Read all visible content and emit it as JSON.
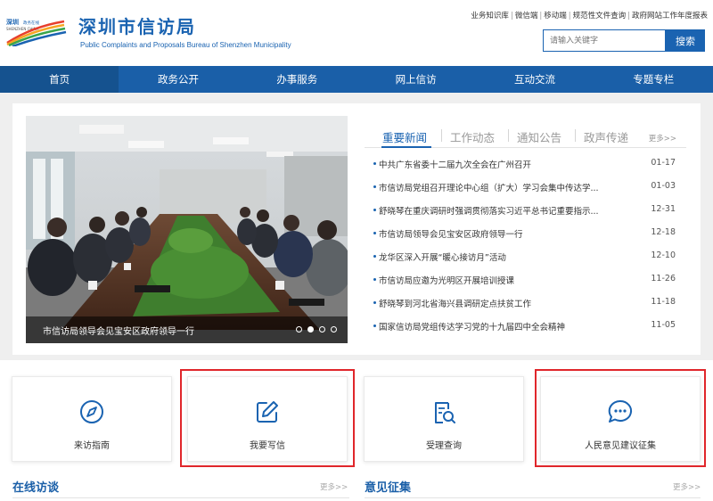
{
  "header": {
    "title": "深圳市信访局",
    "subtitle": "Public Complaints and Proposals Bureau of Shenzhen Municipality",
    "logo_text": "深圳 政务在线 SHENZHEN CHINA",
    "top_links": [
      "业务知识库",
      "微信端",
      "移动端",
      "规范性文件查询",
      "政府网站工作年度报表"
    ],
    "search": {
      "placeholder": "请输入关键字",
      "button_label": "搜索"
    }
  },
  "nav": {
    "items": [
      "首页",
      "政务公开",
      "办事服务",
      "网上信访",
      "互动交流",
      "专题专栏"
    ],
    "active_index": 0
  },
  "slider": {
    "caption": "市信访局领导会见宝安区政府领导一行",
    "dot_count": 4,
    "active_dot": 1
  },
  "news": {
    "tabs": [
      "重要新闻",
      "工作动态",
      "通知公告",
      "政声传递"
    ],
    "active_tab": 0,
    "more_label": "更多>>",
    "items": [
      {
        "title": "中共广东省委十二届九次全会在广州召开",
        "date": "01-17"
      },
      {
        "title": "市信访局党组召开理论中心组（扩大）学习会集中传达学...",
        "date": "01-03"
      },
      {
        "title": "舒晓琴在重庆调研时强调贯彻落实习近平总书记重要指示...",
        "date": "12-31"
      },
      {
        "title": "市信访局领导会见宝安区政府领导一行",
        "date": "12-18"
      },
      {
        "title": "龙华区深入开展“暖心接访月”活动",
        "date": "12-10"
      },
      {
        "title": "市信访局应邀为光明区开展培训授课",
        "date": "11-26"
      },
      {
        "title": "舒晓琴到河北省海兴县调研定点扶贫工作",
        "date": "11-18"
      },
      {
        "title": "国家信访局党组传达学习党的十九届四中全会精神",
        "date": "11-05"
      }
    ]
  },
  "quick_links": [
    {
      "label": "来访指南",
      "icon": "compass-icon",
      "highlighted": false
    },
    {
      "label": "我要写信",
      "icon": "edit-icon",
      "highlighted": true
    },
    {
      "label": "受理查询",
      "icon": "document-search-icon",
      "highlighted": false
    },
    {
      "label": "人民意见建议征集",
      "icon": "chat-bubble-icon",
      "highlighted": true
    }
  ],
  "sections": {
    "left": {
      "title": "在线访谈",
      "more_label": "更多>>"
    },
    "right": {
      "title": "意见征集",
      "more_label": "更多>>"
    }
  },
  "colors": {
    "brand_blue": "#1a63b1",
    "nav_blue": "#1a5fa8",
    "highlight_red": "#e0262b",
    "band_gray": "#efefef"
  }
}
